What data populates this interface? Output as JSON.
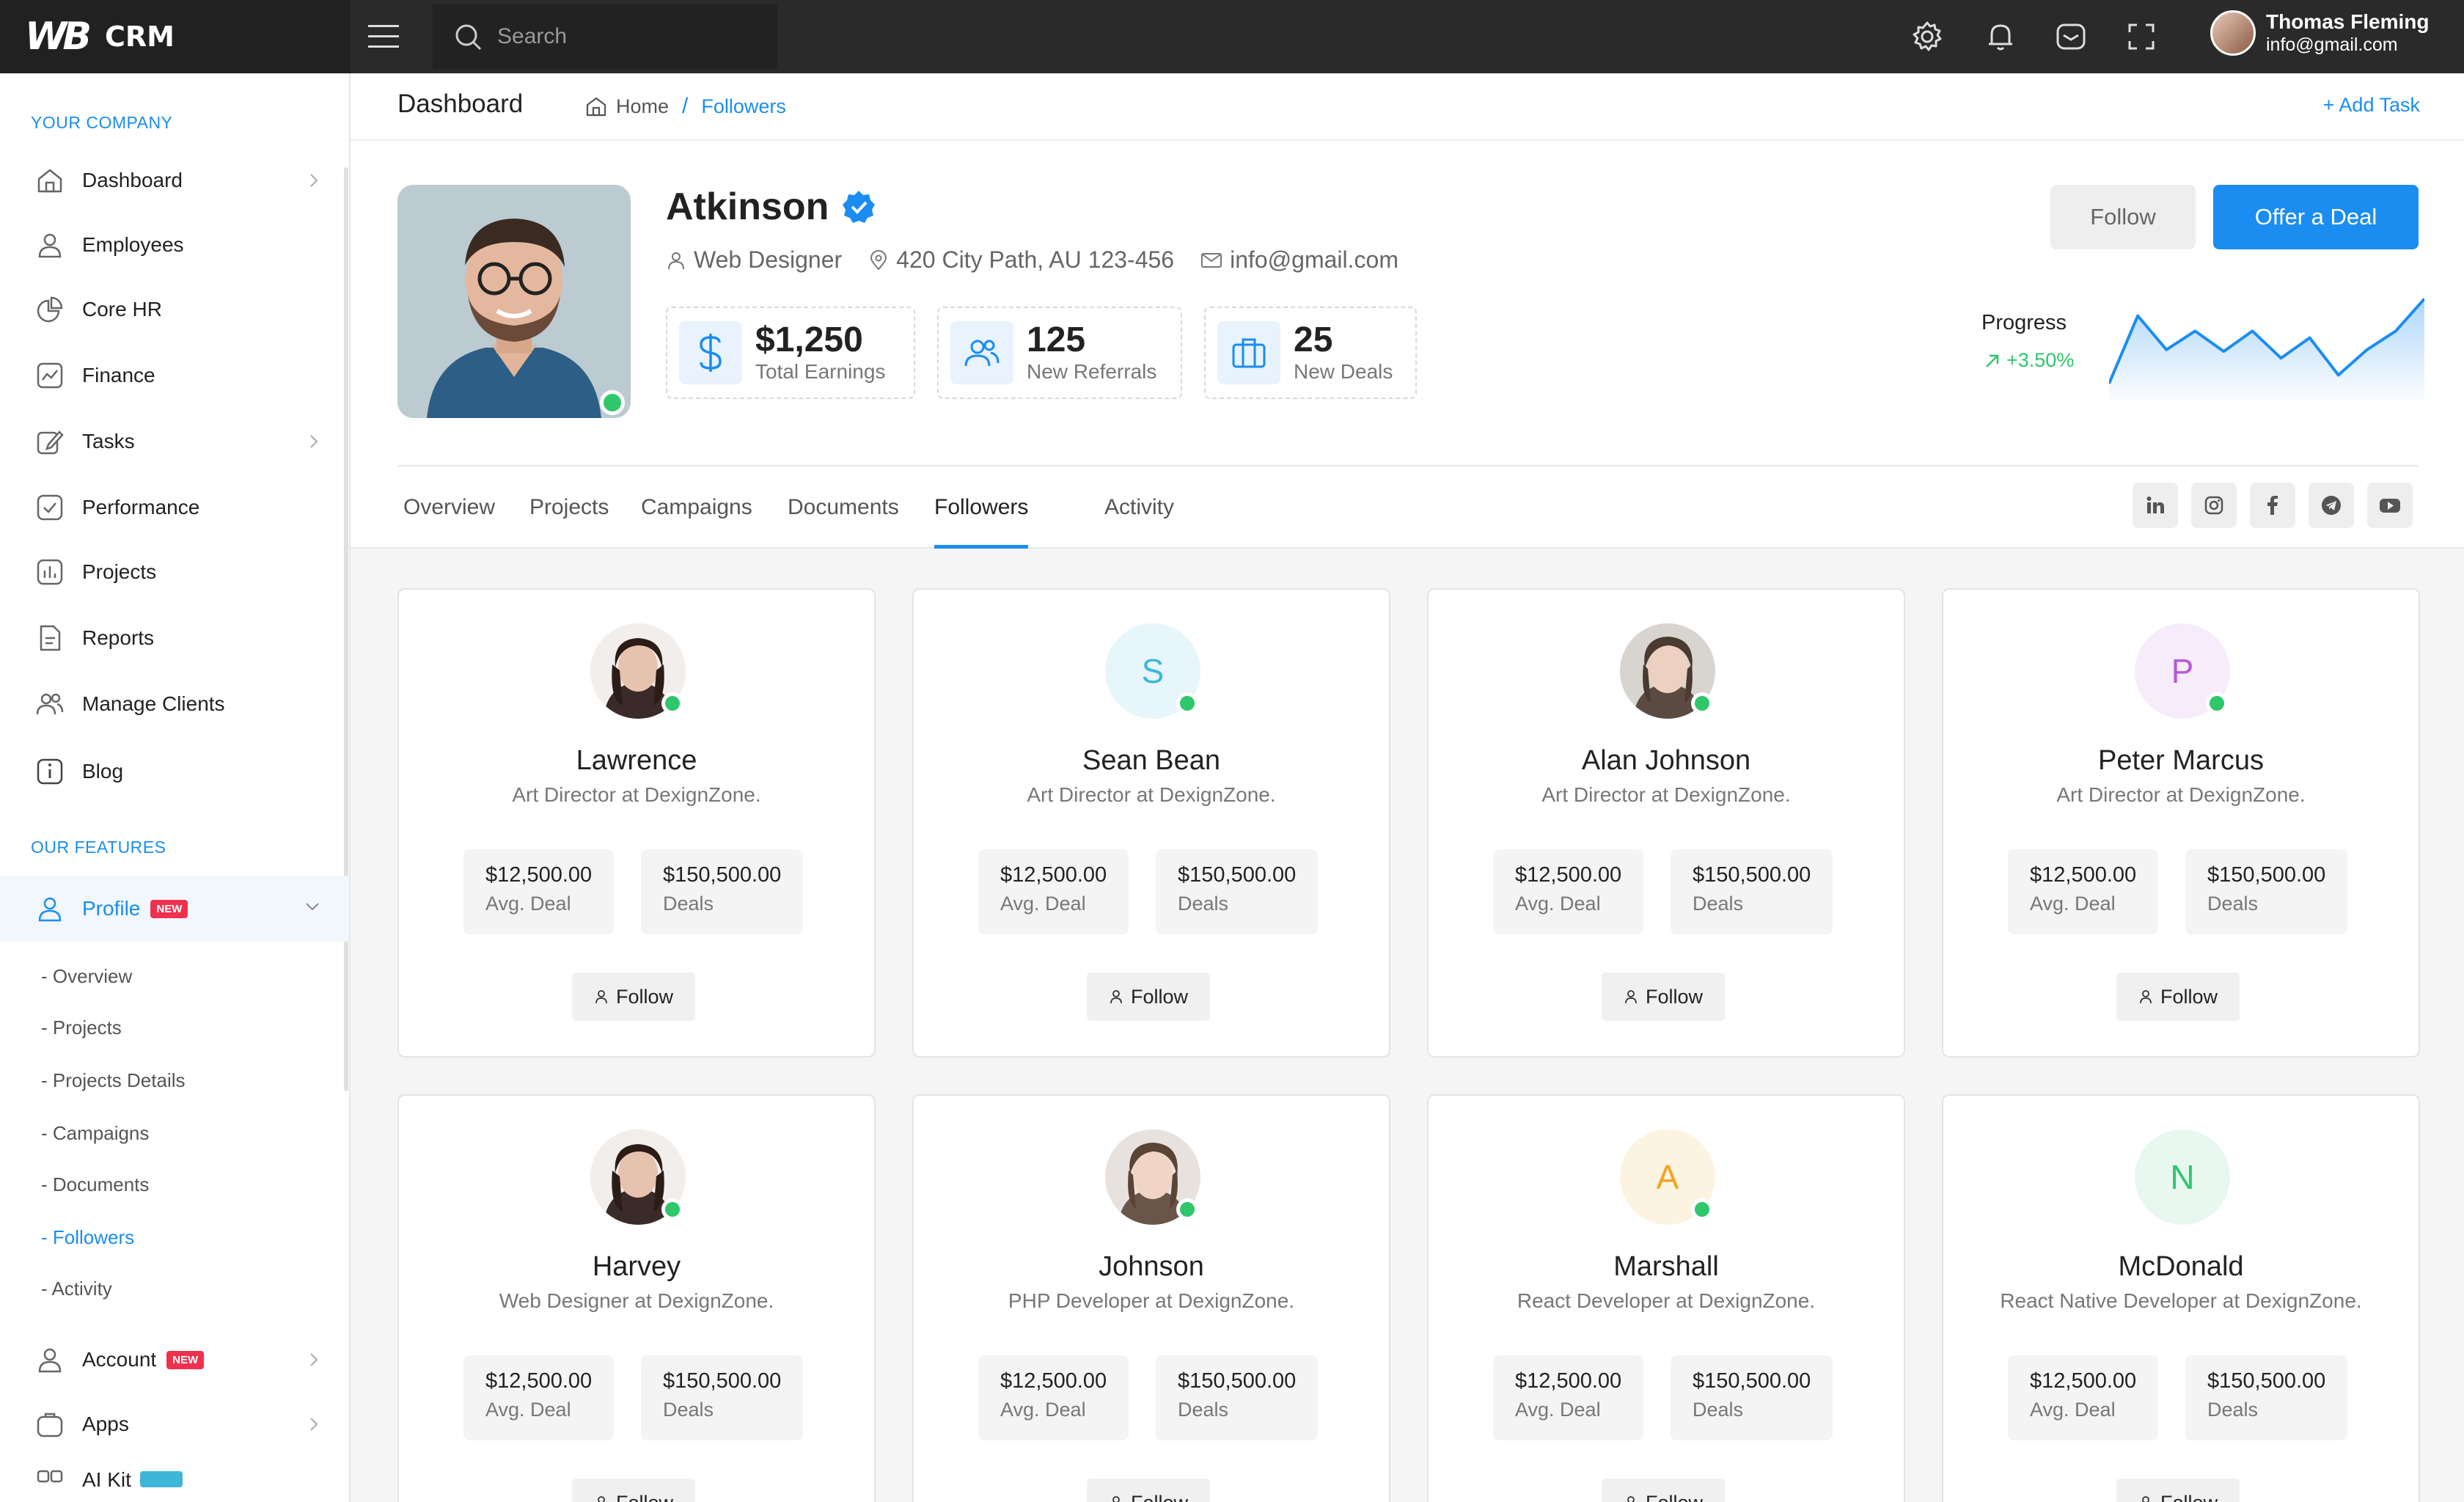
{
  "app": {
    "logo_mark": "WB",
    "name": "CRM"
  },
  "search": {
    "placeholder": "Search"
  },
  "user": {
    "name": "Thomas Fleming",
    "email": "info@gmail.com"
  },
  "sidebar": {
    "section_company": "YOUR COMPANY",
    "section_features": "OUR FEATURES",
    "items": [
      {
        "label": "Dashboard",
        "icon": "home-icon"
      },
      {
        "label": "Employees",
        "icon": "user-icon"
      },
      {
        "label": "Core HR",
        "icon": "pie-chart-icon"
      },
      {
        "label": "Finance",
        "icon": "trend-chart-icon"
      },
      {
        "label": "Tasks",
        "icon": "edit-icon"
      },
      {
        "label": "Performance",
        "icon": "check-square-icon"
      },
      {
        "label": "Projects",
        "icon": "bar-chart-icon"
      },
      {
        "label": "Reports",
        "icon": "file-icon"
      },
      {
        "label": "Manage Clients",
        "icon": "users-icon"
      },
      {
        "label": "Blog",
        "icon": "info-icon"
      }
    ],
    "profile": {
      "label": "Profile",
      "badge": "NEW"
    },
    "sub_items": [
      "- Overview",
      "- Projects",
      "- Projects Details",
      "- Campaigns",
      "- Documents",
      "- Followers",
      "- Activity"
    ],
    "account": {
      "label": "Account",
      "badge": "NEW"
    },
    "apps": {
      "label": "Apps"
    },
    "aikit": {
      "label": "AI Kit"
    }
  },
  "header": {
    "title": "Dashboard",
    "crumb_home": "Home",
    "crumb_sep": "/",
    "crumb_current": "Followers",
    "add_task": "+ Add Task"
  },
  "profile": {
    "name": "Atkinson",
    "role": "Web Designer",
    "address": "420 City Path, AU 123-456",
    "email": "info@gmail.com",
    "stats": [
      {
        "value": "$1,250",
        "label": "Total Earnings"
      },
      {
        "value": "125",
        "label": "New Referrals"
      },
      {
        "value": "25",
        "label": "New Deals"
      }
    ],
    "follow_label": "Follow",
    "offer_label": "Offer a Deal",
    "progress_label": "Progress",
    "progress_value": "+3.50%",
    "sparkline": [
      20,
      100,
      60,
      82,
      58,
      82,
      50,
      74,
      30,
      60,
      82,
      120
    ]
  },
  "tabs": [
    "Overview",
    "Projects",
    "Campaigns",
    "Documents",
    "Followers",
    "Activity"
  ],
  "social": [
    "linkedin-icon",
    "instagram-icon",
    "facebook-icon",
    "telegram-icon",
    "youtube-icon"
  ],
  "followers": [
    {
      "name": "Lawrence",
      "role": "Art Director at DexignZone.",
      "avatar_type": "photo",
      "avg": "$12,500.00",
      "deals": "$150,500.00"
    },
    {
      "name": "Sean Bean",
      "role": "Art Director at DexignZone.",
      "avatar_type": "letter",
      "initial": "S",
      "bg": "#e6f6fb",
      "fg": "#3fb6d8",
      "avg": "$12,500.00",
      "deals": "$150,500.00"
    },
    {
      "name": "Alan Johnson",
      "role": "Art Director at DexignZone.",
      "avatar_type": "photo",
      "avg": "$12,500.00",
      "deals": "$150,500.00"
    },
    {
      "name": "Peter Marcus",
      "role": "Art Director at DexignZone.",
      "avatar_type": "letter",
      "initial": "P",
      "bg": "#f7ecfb",
      "fg": "#b45ad8",
      "avg": "$12,500.00",
      "deals": "$150,500.00"
    },
    {
      "name": "Harvey",
      "role": "Web Designer at DexignZone.",
      "avatar_type": "photo",
      "avg": "$12,500.00",
      "deals": "$150,500.00"
    },
    {
      "name": "Johnson",
      "role": "PHP Developer at DexignZone.",
      "avatar_type": "photo",
      "avg": "$12,500.00",
      "deals": "$150,500.00"
    },
    {
      "name": "Marshall",
      "role": "React Developer at DexignZone.",
      "avatar_type": "letter",
      "initial": "A",
      "bg": "#fdf3e1",
      "fg": "#f2a41e",
      "avg": "$12,500.00",
      "deals": "$150,500.00"
    },
    {
      "name": "McDonald",
      "role": "React Native Developer at DexignZone.",
      "avatar_type": "letter",
      "initial": "N",
      "bg": "#e8f7ef",
      "fg": "#2ec76b",
      "avg": "$12,500.00",
      "deals": "$150,500.00"
    }
  ],
  "card_labels": {
    "avg": "Avg. Deal",
    "deals": "Deals",
    "follow": "Follow"
  },
  "colors": {
    "primary": "#1b8df0",
    "online": "#2ec76b",
    "badge": "#f0314e",
    "topbar": "#2a2a2a"
  }
}
